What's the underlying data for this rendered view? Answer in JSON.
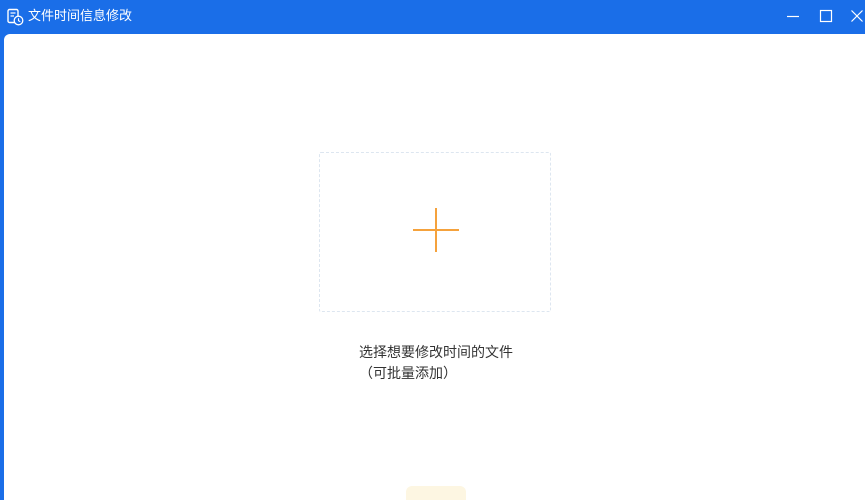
{
  "window": {
    "title": "文件时间信息修改",
    "icon": "document-clock-icon"
  },
  "controls": {
    "minimize_icon": "minimize-icon",
    "maximize_icon": "maximize-icon",
    "close_icon": "close-icon"
  },
  "dropzone": {
    "icon": "plus-icon",
    "hint": "选择想要修改时间的文件（可批量添加）"
  },
  "colors": {
    "titlebar": "#1a6ee8",
    "accent_plus": "#f5a23c",
    "dropzone_border": "#dde6f0",
    "hint_text": "#333333"
  }
}
